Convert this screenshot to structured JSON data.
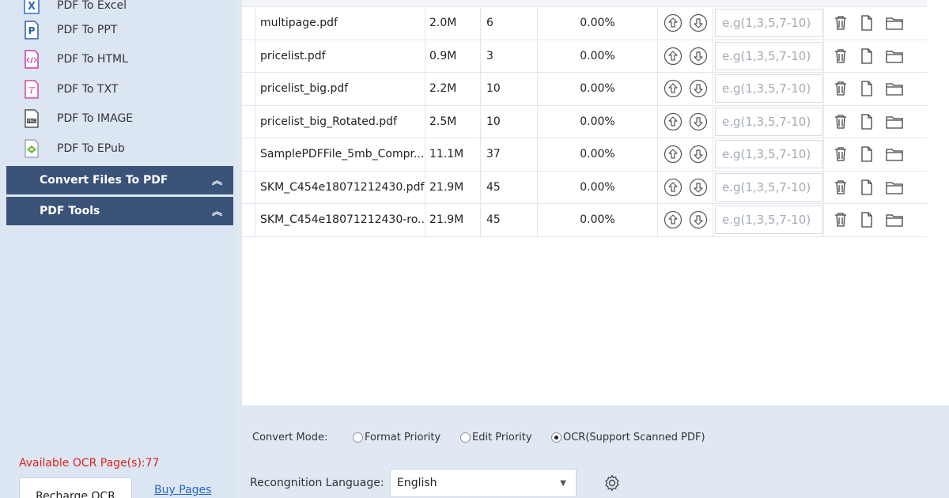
{
  "sidebar": {
    "items": [
      {
        "label": "PDF To Excel",
        "icon": "excel-icon",
        "color": "#2f6fc7"
      },
      {
        "label": "PDF To PPT",
        "icon": "ppt-icon",
        "color": "#2f5fa8"
      },
      {
        "label": "PDF To HTML",
        "icon": "html-icon",
        "color": "#c43fa8"
      },
      {
        "label": "PDF To TXT",
        "icon": "txt-icon",
        "color": "#d8469a"
      },
      {
        "label": "PDF To IMAGE",
        "icon": "image-icon",
        "color": "#555555"
      },
      {
        "label": "PDF To EPub",
        "icon": "epub-icon",
        "color": "#6fb33b"
      }
    ],
    "groups": [
      {
        "label": "Convert Files To PDF",
        "chevron": "︽"
      },
      {
        "label": "PDF Tools",
        "chevron": "︽"
      }
    ],
    "ocr_available": "Available OCR Page(s):77",
    "recharge_label": "Recharge OCR",
    "buy_label": "Buy Pages"
  },
  "files": [
    {
      "name": "multipage.pdf",
      "size": "2.0M",
      "pages": "6",
      "progress": "0.00%"
    },
    {
      "name": "pricelist.pdf",
      "size": "0.9M",
      "pages": "3",
      "progress": "0.00%"
    },
    {
      "name": "pricelist_big.pdf",
      "size": "2.2M",
      "pages": "10",
      "progress": "0.00%"
    },
    {
      "name": "pricelist_big_Rotated.pdf",
      "size": "2.5M",
      "pages": "10",
      "progress": "0.00%"
    },
    {
      "name": "SamplePDFFile_5mb_Compr...",
      "size": "11.1M",
      "pages": "37",
      "progress": "0.00%"
    },
    {
      "name": "SKM_C454e18071212430.pdf",
      "size": "21.9M",
      "pages": "45",
      "progress": "0.00%"
    },
    {
      "name": "SKM_C454e18071212430-ro...",
      "size": "21.9M",
      "pages": "45",
      "progress": "0.00%"
    }
  ],
  "range_placeholder": "e.g(1,3,5,7-10)",
  "options": {
    "mode_label": "Convert Mode:",
    "modes": [
      {
        "label": "Format Priority",
        "selected": false
      },
      {
        "label": "Edit Priority",
        "selected": false
      },
      {
        "label": "OCR(Support Scanned PDF)",
        "selected": true
      }
    ],
    "language_label": "Recongnition Language:",
    "language_value": "English"
  },
  "colors": {
    "sidebar_group_bg": "#3b5378",
    "ocr_text": "#e02020",
    "link": "#2a66c9"
  }
}
